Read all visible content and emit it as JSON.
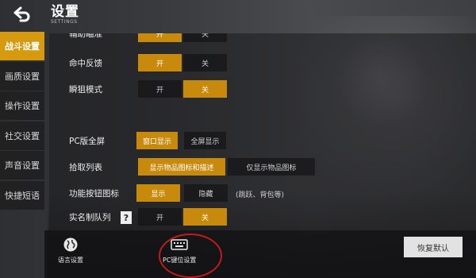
{
  "header": {
    "title": "设置",
    "subtitle": "SETTINGS"
  },
  "sidebar": {
    "items": [
      {
        "label": "战斗设置",
        "active": true
      },
      {
        "label": "画质设置"
      },
      {
        "label": "操作设置"
      },
      {
        "label": "社交设置"
      },
      {
        "label": "声音设置"
      },
      {
        "label": "快捷短语"
      }
    ]
  },
  "settings": {
    "partial_row": {
      "label": "辅助瞄准",
      "on": "开",
      "off": "关"
    },
    "hit_feedback": {
      "label": "命中反馈",
      "on": "开",
      "off": "关"
    },
    "instant_scope": {
      "label": "瞬狙模式",
      "on": "开",
      "off": "关"
    },
    "pc_fullscreen": {
      "label": "PC版全屏",
      "windowed": "窗口显示",
      "fullscreen": "全屏显示"
    },
    "pickup_list": {
      "label": "拾取列表",
      "opt_full": "显示物品图标和描述",
      "opt_icon": "仅显示物品图标"
    },
    "func_icons": {
      "label": "功能按钮图标",
      "show": "显示",
      "hide": "隐藏",
      "hint": "(跳跃、背包等)"
    },
    "real_name_queue": {
      "label": "实名制队列",
      "help": "?",
      "on": "开",
      "off": "关"
    }
  },
  "bottom": {
    "language_label": "语言设置",
    "pc_keys_label": "PC键位设置",
    "reset_label": "恢复默认"
  },
  "colors": {
    "accent": "#c88a0c",
    "active_tab": "#d69a10",
    "highlight_circle": "#c21b1b"
  }
}
